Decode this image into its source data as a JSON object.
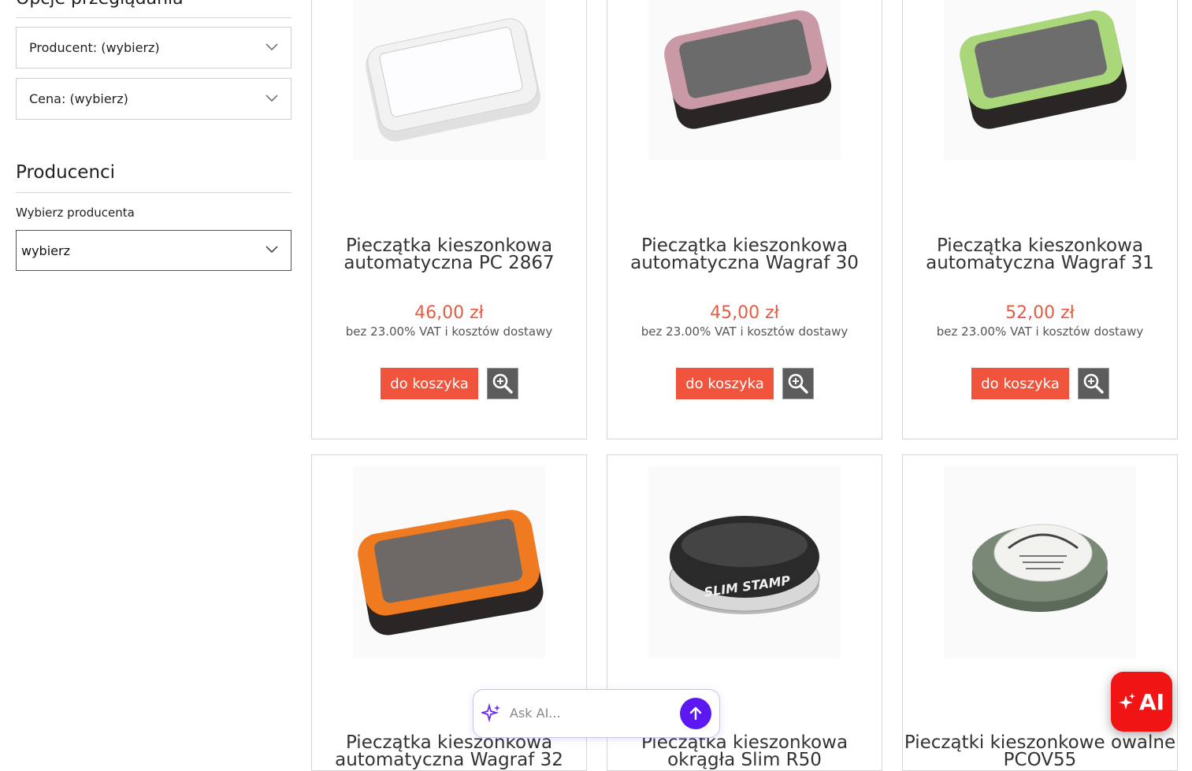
{
  "sidebar": {
    "options_title": "Opcje przeglądania",
    "filter_producer": "Producent: (wybierz)",
    "filter_price": "Cena: (wybierz)",
    "producers_title": "Producenci",
    "choose_producer_label": "Wybierz producenta",
    "choose_producer_value": "wybierz"
  },
  "products": [
    {
      "name_line1": "Pieczątka kieszonkowa",
      "name_line2": "automatyczna PC 2867",
      "price": "46,00 zł",
      "vat": "bez 23.00% VAT i kosztów dostawy",
      "cart": "do koszyka",
      "color": "#f2f2f2"
    },
    {
      "name_line1": "Pieczątka kieszonkowa",
      "name_line2": "automatyczna Wagraf 30",
      "price": "45,00 zł",
      "vat": "bez 23.00% VAT i kosztów dostawy",
      "cart": "do koszyka",
      "color": "#c99aa5"
    },
    {
      "name_line1": "Pieczątka kieszonkowa",
      "name_line2": "automatyczna Wagraf 31",
      "price": "52,00 zł",
      "vat": "bez 23.00% VAT i kosztów dostawy",
      "cart": "do koszyka",
      "color": "#a9d779"
    },
    {
      "name_line1": "Pieczątka kieszonkowa",
      "name_line2": "automatyczna Wagraf 32",
      "color": "#f07a1f"
    },
    {
      "name_line1": "Pieczątka kieszonkowa",
      "name_line2": "okrągła Slim R50",
      "stamp_text": "SLIM STAMP",
      "color": "#2a2a2a"
    },
    {
      "name_line1": "Pieczątki kieszonkowe owalne",
      "name_line2": "PCOV55",
      "color": "#6e7a6a"
    }
  ],
  "ask_ai": {
    "placeholder": "Ask AI...",
    "fab_label": "AI"
  }
}
